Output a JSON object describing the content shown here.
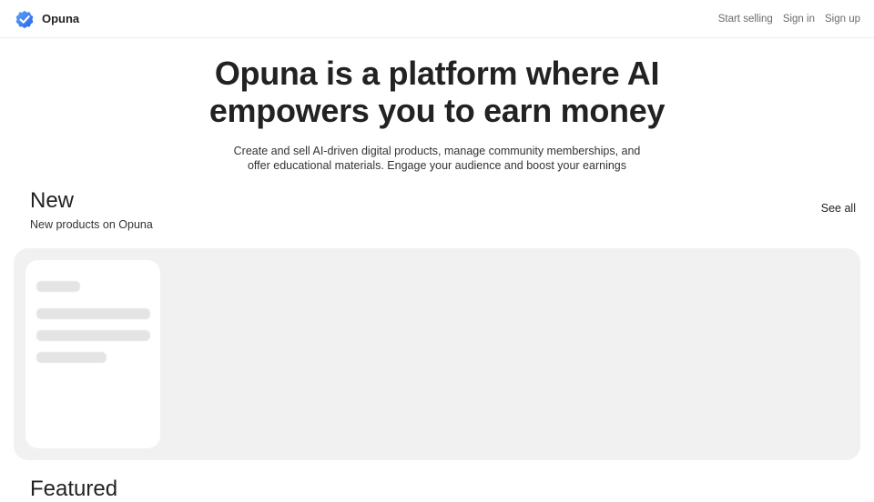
{
  "header": {
    "brand_name": "Opuna",
    "brand_color": "#3b82f6",
    "logo_icon": "verified-badge-icon",
    "nav": {
      "start_selling": "Start selling",
      "sign_in": "Sign in",
      "sign_up": "Sign up"
    }
  },
  "hero": {
    "title_line1": "Opuna is a platform where AI",
    "title_line2": "empowers you to earn money",
    "subtitle_line1": "Create and sell AI-driven digital products, manage community memberships, and",
    "subtitle_line2": "offer educational materials. Engage your audience and boost your earnings"
  },
  "new_section": {
    "title": "New",
    "subtitle": "New products on Opuna",
    "see_all": "See all",
    "loading": true
  },
  "featured_section": {
    "title": "Featured"
  }
}
